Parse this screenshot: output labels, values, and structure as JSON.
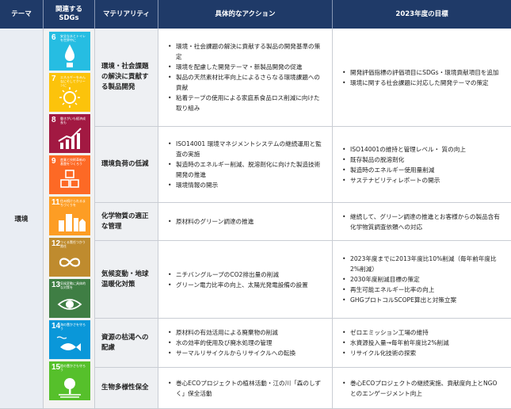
{
  "headers": {
    "theme": "テーマ",
    "sdgs": "関連する\nSDGs",
    "materiality": "マテリアリティ",
    "actions": "具体的なアクション",
    "goals": "2023年度の目標"
  },
  "theme_value": "環境",
  "sdg_icons": [
    {
      "num": "6",
      "caption": "安全な水とトイレを世界中に",
      "color": "#26bde2",
      "icon": "water-drop-icon"
    },
    {
      "num": "7",
      "caption": "エネルギーをみんなにそしてクリーンに",
      "color": "#fcc30b",
      "icon": "sun-icon"
    },
    {
      "num": "8",
      "caption": "働きがいも経済成長も",
      "color": "#a21942",
      "icon": "growth-chart-icon"
    },
    {
      "num": "9",
      "caption": "産業と技術革新の基盤をつくろう",
      "color": "#fd6925",
      "icon": "cubes-icon"
    },
    {
      "num": "11",
      "caption": "住み続けられるまちづくりを",
      "color": "#fd9d24",
      "icon": "city-icon"
    },
    {
      "num": "12",
      "caption": "つくる責任つかう責任",
      "color": "#bf8b2e",
      "icon": "infinity-icon"
    },
    {
      "num": "13",
      "caption": "気候変動に具体的な対策を",
      "color": "#3f7e44",
      "icon": "eye-globe-icon"
    },
    {
      "num": "14",
      "caption": "海の豊かさを守ろう",
      "color": "#0a97d9",
      "icon": "fish-icon"
    },
    {
      "num": "15",
      "caption": "陸の豊かさも守ろう",
      "color": "#56c02b",
      "icon": "tree-icon"
    }
  ],
  "rows": [
    {
      "materiality": "環境・社会課題の解決に貢献する製品開発",
      "actions": [
        "環境・社会課題の解決に貢献する製品の開発基準の策定",
        "環境を配慮した開発テーマ・新製品開発の促進",
        "製品の天然素材比率向上によるさらなる環境課題への貢献",
        "粘着テープの使用による家庭系食品ロス削減に向けた取り組み"
      ],
      "goals": [
        "開発評価指標の評価項目にSDGs・環境貢献項目を追加",
        "環境に関する社会課題に対応した開発テーマの策定"
      ]
    },
    {
      "materiality": "環境負荷の低減",
      "actions": [
        "ISO14001 環境マネジメントシステムの継続運用と監査の実施",
        "製造時のエネルギー削減、脱溶剤化に向けた製造技術開発の推進",
        "環境情報の開示"
      ],
      "goals": [
        "ISO14001の維持と管理レベル・ 質の向上",
        "既存製品の脱溶剤化",
        "製造時のエネルギー使用量削減",
        "サステナビリティレポートの開示"
      ]
    },
    {
      "materiality": "化学物質の適正な管理",
      "actions": [
        "原材料のグリーン調達の推進"
      ],
      "goals": [
        "継続して、グリーン調達の推進とお客様からの製品含有化学物質調査依頼への対応"
      ]
    },
    {
      "materiality": "気候変動・地球温暖化対策",
      "actions": [
        "ニチバングループのCO2排出量の削減",
        "グリーン電力比率の向上、太陽光発電設備の設置"
      ],
      "goals": [
        "2023年度までに2013年度比10%削減（毎年前年度比2%削減）",
        "2030年度削減目標の策定",
        "再生可能エネルギー比率の向上",
        "GHGプロトコルSCOPE算出と対策立案"
      ]
    },
    {
      "materiality": "資源の枯渇への配慮",
      "actions": [
        "原材料の有効活用による廃棄物の削減",
        "水の効率的使用及び廃水処理の管理",
        "サーマルリサイクルからリサイクルへの転換"
      ],
      "goals": [
        "ゼロエミッション工場の維持",
        "水資源投入量→毎年前年度比2%削減",
        "リサイクル化技術の探索"
      ]
    },
    {
      "materiality": "生物多様性保全",
      "actions": [
        "巻心ECOプロジェクトの植林活動・江の川「森のしずく」保全活動"
      ],
      "goals": [
        "巻心ECOプロジェクトの継続実施、貢献度向上とNGOとのエンゲージメント向上"
      ]
    }
  ]
}
